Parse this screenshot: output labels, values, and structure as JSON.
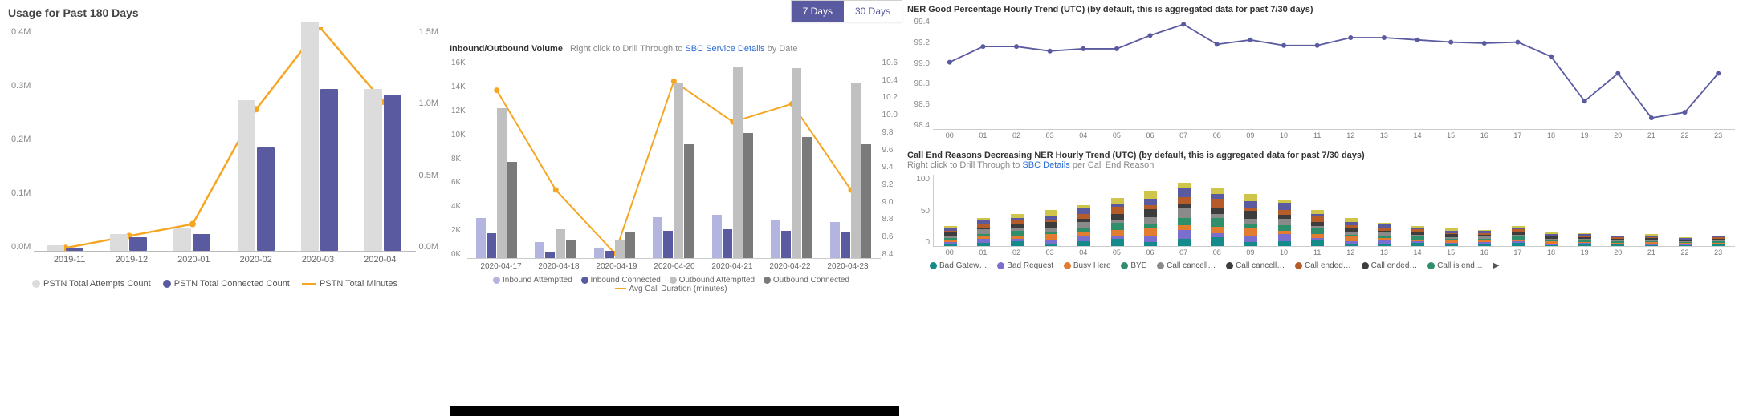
{
  "panel1": {
    "title": "Usage for Past 180 Days",
    "y_left": [
      "0.4M",
      "0.3M",
      "0.2M",
      "0.1M",
      "0.0M"
    ],
    "y_right": [
      "1.5M",
      "1.0M",
      "0.5M",
      "0.0M"
    ],
    "x": [
      "2019-11",
      "2019-12",
      "2020-01",
      "2020-02",
      "2020-03",
      "2020-04"
    ],
    "legend": {
      "attempts": "PSTN Total Attempts Count",
      "connected": "PSTN Total Connected Count",
      "minutes": "PSTN Total Minutes"
    },
    "colors": {
      "attempts": "#dcdcdc",
      "connected": "#5a5aa0",
      "minutes": "#f5a623"
    }
  },
  "panel2": {
    "toggle": {
      "t7": "7 Days",
      "t30": "30 Days"
    },
    "title": "Inbound/Outbound Volume",
    "hint_pre": "Right click to Drill Through to",
    "hint_link": "SBC Service Details",
    "hint_post": "by Date",
    "y_left": [
      "16K",
      "14K",
      "12K",
      "10K",
      "8K",
      "6K",
      "4K",
      "2K",
      "0K"
    ],
    "y_right": [
      "10.6",
      "10.4",
      "10.2",
      "10.0",
      "9.8",
      "9.6",
      "9.4",
      "9.2",
      "9.0",
      "8.8",
      "8.6",
      "8.4"
    ],
    "x": [
      "2020-04-17",
      "2020-04-18",
      "2020-04-19",
      "2020-04-20",
      "2020-04-21",
      "2020-04-22",
      "2020-04-23"
    ],
    "legend": {
      "ia": "Inbound Attemptted",
      "ic": "Inbound Connected",
      "oa": "Outbound Attemptted",
      "oc": "Outbound Connected",
      "dur": "Avg Call Duration (minutes)"
    },
    "colors": {
      "ia": "#b4b4e0",
      "ic": "#5a5aa0",
      "oa": "#c0c0c0",
      "oc": "#7a7a7a",
      "dur": "#f5a623"
    }
  },
  "panel3a": {
    "title": "NER Good Percentage Hourly Trend (UTC) (by default, this is aggregated data for past 7/30 days)",
    "y": [
      "99.4",
      "99.2",
      "99.0",
      "98.8",
      "98.6",
      "98.4"
    ],
    "x": [
      "00",
      "01",
      "02",
      "03",
      "04",
      "05",
      "06",
      "07",
      "08",
      "09",
      "10",
      "11",
      "12",
      "13",
      "14",
      "15",
      "16",
      "17",
      "18",
      "19",
      "20",
      "21",
      "22",
      "23"
    ],
    "color": "#5a5aa0"
  },
  "panel3b": {
    "title": "Call End Reasons Decreasing NER Hourly Trend (UTC) (by default, this is aggregated data for past 7/30 days)",
    "hint_pre": "Right click to Drill Through to",
    "hint_link": "SBC Details",
    "hint_post": "per Call End Reason",
    "y": [
      "100",
      "50",
      "0"
    ],
    "x": [
      "00",
      "01",
      "02",
      "03",
      "04",
      "05",
      "06",
      "07",
      "08",
      "09",
      "10",
      "11",
      "12",
      "13",
      "14",
      "15",
      "16",
      "17",
      "18",
      "19",
      "20",
      "21",
      "22",
      "23"
    ],
    "legend": {
      "l0": "Bad Gatew…",
      "l1": "Bad Request",
      "l2": "Busy Here",
      "l3": "BYE",
      "l4": "Call cancell…",
      "l5": "Call cancell…",
      "l6": "Call ended…",
      "l7": "Call ended…",
      "l8": "Call is end…"
    },
    "legend_colors": {
      "l0": "#158a8a",
      "l1": "#7a6fcf",
      "l2": "#e27c30",
      "l3": "#2f8f6a",
      "l4": "#8a8a8a",
      "l5": "#3d3d3d",
      "l6": "#b55c2a",
      "l7": "#3d3d3d",
      "l8": "#2f8f6a"
    }
  },
  "chart_data": [
    {
      "id": "usage_180_days",
      "type": "bar+line",
      "title": "Usage for Past 180 Days",
      "categories": [
        "2019-11",
        "2019-12",
        "2020-01",
        "2020-02",
        "2020-03",
        "2020-04"
      ],
      "series": [
        {
          "name": "PSTN Total Attempts Count",
          "axis": "left",
          "kind": "bar",
          "values": [
            10000,
            30000,
            40000,
            270000,
            410000,
            290000
          ]
        },
        {
          "name": "PSTN Total Connected Count",
          "axis": "left",
          "kind": "bar",
          "values": [
            5000,
            25000,
            30000,
            185000,
            290000,
            280000
          ]
        },
        {
          "name": "PSTN Total Minutes",
          "axis": "right",
          "kind": "line",
          "values": [
            20000,
            100000,
            180000,
            950000,
            1500000,
            1000000
          ]
        }
      ],
      "ylim_left": [
        0,
        400000
      ],
      "ylim_right": [
        0,
        1500000
      ]
    },
    {
      "id": "inbound_outbound_volume",
      "type": "bar+line",
      "title": "Inbound/Outbound Volume",
      "categories": [
        "2020-04-17",
        "2020-04-18",
        "2020-04-19",
        "2020-04-20",
        "2020-04-21",
        "2020-04-22",
        "2020-04-23"
      ],
      "series": [
        {
          "name": "Inbound Attemptted",
          "axis": "left",
          "kind": "bar",
          "values": [
            3200,
            1300,
            800,
            3300,
            3500,
            3100,
            2900
          ]
        },
        {
          "name": "Inbound Connected",
          "axis": "left",
          "kind": "bar",
          "values": [
            2000,
            500,
            600,
            2200,
            2300,
            2200,
            2100
          ]
        },
        {
          "name": "Outbound Attemptted",
          "axis": "left",
          "kind": "bar",
          "values": [
            12000,
            2300,
            1500,
            14000,
            15300,
            15200,
            14000
          ]
        },
        {
          "name": "Outbound Connected",
          "axis": "left",
          "kind": "bar",
          "values": [
            7700,
            1500,
            2100,
            9100,
            10000,
            9700,
            9100
          ]
        },
        {
          "name": "Avg Call Duration (minutes)",
          "axis": "right",
          "kind": "line",
          "values": [
            10.25,
            9.15,
            8.45,
            10.35,
            9.9,
            10.1,
            9.15
          ]
        }
      ],
      "ylim_left": [
        0,
        16000
      ],
      "ylim_right": [
        8.4,
        10.6
      ]
    },
    {
      "id": "ner_good_percentage_hourly",
      "type": "line",
      "title": "NER Good Percentage Hourly Trend (UTC)",
      "x": [
        0,
        1,
        2,
        3,
        4,
        5,
        6,
        7,
        8,
        9,
        10,
        11,
        12,
        13,
        14,
        15,
        16,
        17,
        18,
        19,
        20,
        21,
        22,
        23
      ],
      "series": [
        {
          "name": "NER Good %",
          "values": [
            99.0,
            99.14,
            99.14,
            99.1,
            99.12,
            99.12,
            99.24,
            99.34,
            99.16,
            99.2,
            99.15,
            99.15,
            99.22,
            99.22,
            99.2,
            99.18,
            99.17,
            99.18,
            99.05,
            98.65,
            98.9,
            98.5,
            98.55,
            98.9
          ]
        }
      ],
      "ylim": [
        98.4,
        99.4
      ]
    },
    {
      "id": "call_end_reasons_hourly",
      "type": "stacked-bar",
      "title": "Call End Reasons Decreasing NER Hourly Trend (UTC)",
      "x": [
        0,
        1,
        2,
        3,
        4,
        5,
        6,
        7,
        8,
        9,
        10,
        11,
        12,
        13,
        14,
        15,
        16,
        17,
        18,
        19,
        20,
        21,
        22,
        23
      ],
      "totals": [
        35,
        48,
        55,
        62,
        70,
        82,
        95,
        108,
        100,
        90,
        80,
        62,
        48,
        40,
        35,
        30,
        28,
        35,
        25,
        22,
        18,
        20,
        15,
        18
      ],
      "stack_order": [
        "Bad Gateway",
        "Bad Request",
        "Busy Here",
        "BYE",
        "Call cancelled A",
        "Call cancelled B",
        "Call ended A",
        "Call ended B",
        "Call is ended"
      ],
      "ylim": [
        0,
        110
      ]
    }
  ]
}
